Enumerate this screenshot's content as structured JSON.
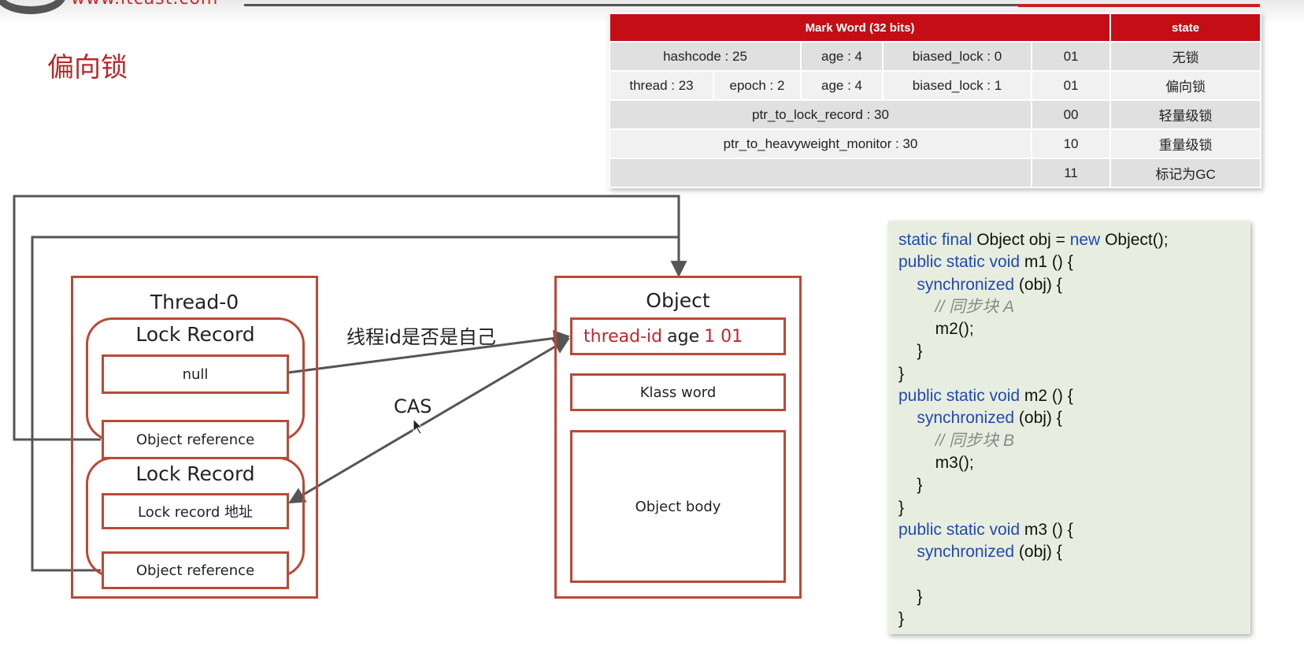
{
  "header": {
    "logo_text": "www.itcast.com",
    "title": "偏向锁"
  },
  "mark_word_table": {
    "header": {
      "mark_word": "Mark Word (32 bits)",
      "state": "state"
    },
    "rows": [
      {
        "hashcode": "hashcode : 25",
        "age": "age : 4",
        "biased_lock": "biased_lock : 0",
        "bits": "01",
        "state": "无锁"
      },
      {
        "thread": "thread : 23",
        "epoch": "epoch : 2",
        "age": "age : 4",
        "biased_lock": "biased_lock : 1",
        "bits": "01",
        "state": "偏向锁"
      },
      {
        "ptr": "ptr_to_lock_record : 30",
        "bits": "00",
        "state": "轻量级锁"
      },
      {
        "ptr": "ptr_to_heavyweight_monitor : 30",
        "bits": "10",
        "state": "重量级锁"
      },
      {
        "bits": "11",
        "state": "标记为GC"
      }
    ]
  },
  "diagram": {
    "thread": {
      "title": "Thread-0",
      "lock_records": [
        {
          "title": "Lock Record",
          "top": "null",
          "bottom": "Object reference"
        },
        {
          "title": "Lock Record",
          "top": "Lock record 地址",
          "bottom": "Object reference"
        }
      ]
    },
    "object": {
      "title": "Object",
      "header_parts": {
        "thread_id": "thread-id",
        "age": "age",
        "bits": "1 01"
      },
      "klass_word": "Klass word",
      "body": "Object body"
    },
    "labels": {
      "check": "线程id是否是自己",
      "cas": "CAS"
    },
    "colors": {
      "box_border": "#b94a36",
      "accent_red": "#c1272d",
      "arrow": "#555555"
    }
  },
  "code": {
    "lines": [
      [
        {
          "t": "static final ",
          "k": "kw"
        },
        {
          "t": "Object obj = ",
          "k": ""
        },
        {
          "t": "new ",
          "k": "kw"
        },
        {
          "t": "Object();",
          "k": ""
        }
      ],
      [
        {
          "t": "public static void ",
          "k": "kw"
        },
        {
          "t": "m1 () {",
          "k": ""
        }
      ],
      [
        {
          "t": "    synchronized ",
          "k": "kw"
        },
        {
          "t": "(obj) {",
          "k": ""
        }
      ],
      [
        {
          "t": "        // 同步块 A",
          "k": "cm"
        }
      ],
      [
        {
          "t": "        m2();",
          "k": ""
        }
      ],
      [
        {
          "t": "    }",
          "k": ""
        }
      ],
      [
        {
          "t": "}",
          "k": ""
        }
      ],
      [
        {
          "t": "public static void ",
          "k": "kw"
        },
        {
          "t": "m2 () {",
          "k": ""
        }
      ],
      [
        {
          "t": "    synchronized ",
          "k": "kw"
        },
        {
          "t": "(obj) {",
          "k": ""
        }
      ],
      [
        {
          "t": "        // 同步块 B",
          "k": "cm"
        }
      ],
      [
        {
          "t": "        m3();",
          "k": ""
        }
      ],
      [
        {
          "t": "    }",
          "k": ""
        }
      ],
      [
        {
          "t": "}",
          "k": ""
        }
      ],
      [
        {
          "t": "public static void ",
          "k": "kw"
        },
        {
          "t": "m3 () {",
          "k": ""
        }
      ],
      [
        {
          "t": "    synchronized ",
          "k": "kw"
        },
        {
          "t": "(obj) {",
          "k": ""
        }
      ],
      [
        {
          "t": "",
          "k": ""
        }
      ],
      [
        {
          "t": "    }",
          "k": ""
        }
      ],
      [
        {
          "t": "}",
          "k": ""
        }
      ]
    ]
  }
}
